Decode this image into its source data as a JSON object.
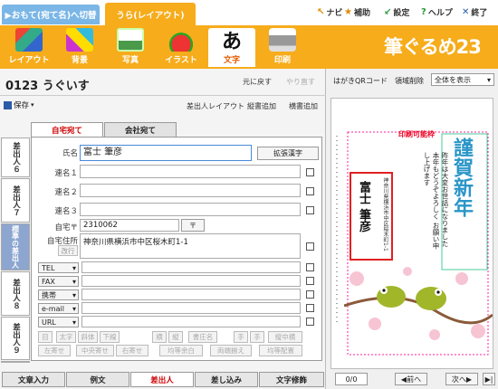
{
  "top": {
    "tab_front": "▶おもて(宛て名)へ切替",
    "tab_back": "うら(レイアウト)",
    "links": [
      {
        "icon": "↖",
        "label": "ナビ"
      },
      {
        "icon": "★",
        "label": "補助"
      },
      {
        "icon": "↙",
        "label": "設定"
      },
      {
        "icon": "?",
        "label": "ヘルプ"
      },
      {
        "icon": "✕",
        "label": "終了"
      }
    ]
  },
  "toolbar": {
    "items": [
      "レイアウト",
      "背景",
      "写真",
      "イラスト",
      "文字",
      "印刷"
    ],
    "active": "文字",
    "brand": "筆ぐるめ23"
  },
  "header": {
    "title": "0123 うぐいす",
    "undo": "元に戻す",
    "redo": "やり直す",
    "save": "保存",
    "sender_layout": "差出人レイアウト",
    "add_vertical": "縦書追加",
    "add_horizontal": "横書追加"
  },
  "form": {
    "tab_home": "自宅宛て",
    "tab_work": "会社宛て",
    "name_label": "氏名",
    "name_value": "富士 筆彦",
    "ext_kanji": "拡張漢字",
    "joint_labels": [
      "連名１",
      "連名２",
      "連名３"
    ],
    "postal_label": "自宅〒",
    "postal_value": "2310062",
    "postal_btn": "〒",
    "address_label": "自宅住所",
    "address_value": "神奈川県横浜市中区桜木町1-1",
    "newline_btn": "改行",
    "contact_types": [
      "TEL",
      "FAX",
      "携帯",
      "e-mail",
      "URL"
    ],
    "fmt_row1": [
      "太字",
      "斜体",
      "下線",
      "横",
      "縦",
      "書庄名",
      "手",
      "手",
      "縦中横"
    ],
    "fmt_row2": [
      "左寄せ",
      "中央寄せ",
      "右寄せ",
      "均等余白",
      "両端揃え",
      "均等配置"
    ],
    "fmt_icon": "目"
  },
  "side_tabs": [
    "差出人６",
    "差出人７",
    "標準の差出人",
    "差出人８",
    "差出人９",
    "差出人１０"
  ],
  "bottom_tabs": [
    "文章入力",
    "例文",
    "差出人",
    "差し込み",
    "文字修飾"
  ],
  "bottom_active": "差出人",
  "preview": {
    "hagaki": "はがき",
    "qr": "QRコード",
    "delete_area": "領域削除",
    "view_select": "全体を表示",
    "printable": "印刷可能枠",
    "greeting": "謹賀新年",
    "message": "昨年は大変お世話になりました 本年もどうぞよろしく お願い申し上げます",
    "date": "令和六年元旦",
    "sender_name": "富士 筆彦",
    "sender_addr": "神奈川県横浜市中区桜木町1-1",
    "page": "0/0",
    "prev": "前へ",
    "next": "次へ"
  }
}
